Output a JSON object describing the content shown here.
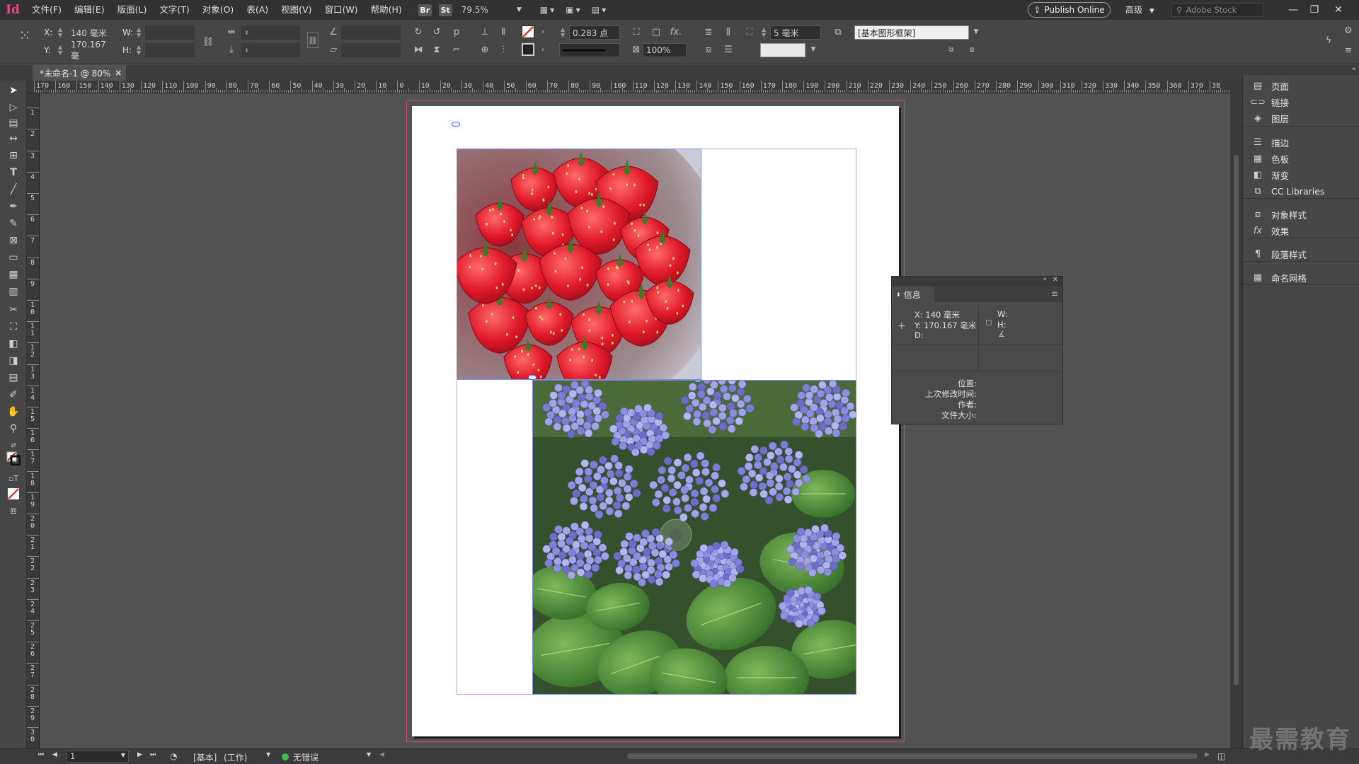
{
  "app": {
    "logo": "Id",
    "brand_color": "#ff3d8b"
  },
  "menu": [
    "文件(F)",
    "编辑(E)",
    "版面(L)",
    "文字(T)",
    "对象(O)",
    "表(A)",
    "视图(V)",
    "窗口(W)",
    "帮助(H)"
  ],
  "menubar": {
    "bridge": "Br",
    "stock": "St",
    "zoom": "79.5%",
    "publish": "Publish Online",
    "workspace": "高级",
    "search_placeholder": "Adobe Stock"
  },
  "control": {
    "x_label": "X:",
    "x_value": "140 毫米",
    "y_label": "Y:",
    "y_value": "170.167 毫",
    "w_label": "W:",
    "h_label": "H:",
    "stroke_weight": "0.283 点",
    "scale": "100%",
    "gap": "5 毫米",
    "object_style": "[基本图形框架]"
  },
  "doc_tab": {
    "title": "*未命名-1 @ 80%",
    "close": "×"
  },
  "ruler_h": [
    170,
    160,
    150,
    140,
    130,
    120,
    110,
    100,
    90,
    80,
    70,
    60,
    50,
    40,
    30,
    20,
    10,
    0,
    10,
    20,
    30,
    40,
    50,
    60,
    70,
    80,
    90,
    100,
    110,
    120,
    130,
    140,
    150,
    160,
    170,
    180,
    190,
    200,
    210,
    220,
    230,
    240,
    250,
    260,
    270,
    280,
    290,
    300,
    310,
    320,
    330,
    340,
    350,
    360,
    370,
    38
  ],
  "ruler_v": [
    "0",
    "1",
    "2",
    "3",
    "4",
    "5",
    "6",
    "7",
    "8",
    "9",
    "10",
    "11",
    "12",
    "13",
    "14",
    "15",
    "16",
    "17",
    "18",
    "19",
    "20",
    "21",
    "22",
    "23",
    "24",
    "25",
    "26",
    "27",
    "28",
    "29",
    "30"
  ],
  "info_panel": {
    "tab": "信息",
    "x": "X: 140 毫米",
    "y": "Y: 170.167 毫米",
    "d": "D:",
    "w": "W:",
    "h": "H:",
    "meta": [
      "位置:",
      "上次修改时间:",
      "作者:",
      "文件大小:"
    ]
  },
  "dock": [
    {
      "label": "页面",
      "icon": "pages-icon"
    },
    {
      "label": "链接",
      "icon": "links-icon"
    },
    {
      "label": "图层",
      "icon": "layers-icon"
    },
    {
      "label": "描边",
      "icon": "stroke-icon"
    },
    {
      "label": "色板",
      "icon": "swatches-icon"
    },
    {
      "label": "渐变",
      "icon": "gradient-icon"
    },
    {
      "label": "CC Libraries",
      "icon": "cc-libraries-icon"
    },
    {
      "label": "对象样式",
      "icon": "object-styles-icon"
    },
    {
      "label": "效果",
      "icon": "effects-icon"
    },
    {
      "label": "段落样式",
      "icon": "paragraph-styles-icon"
    },
    {
      "label": "命名网格",
      "icon": "named-grid-icon"
    }
  ],
  "statusbar": {
    "page": "1",
    "style": "[基本]",
    "mode": "(工作)",
    "errors": "无错误",
    "status_color": "#3fbf4f"
  },
  "watermark": "最需教育"
}
